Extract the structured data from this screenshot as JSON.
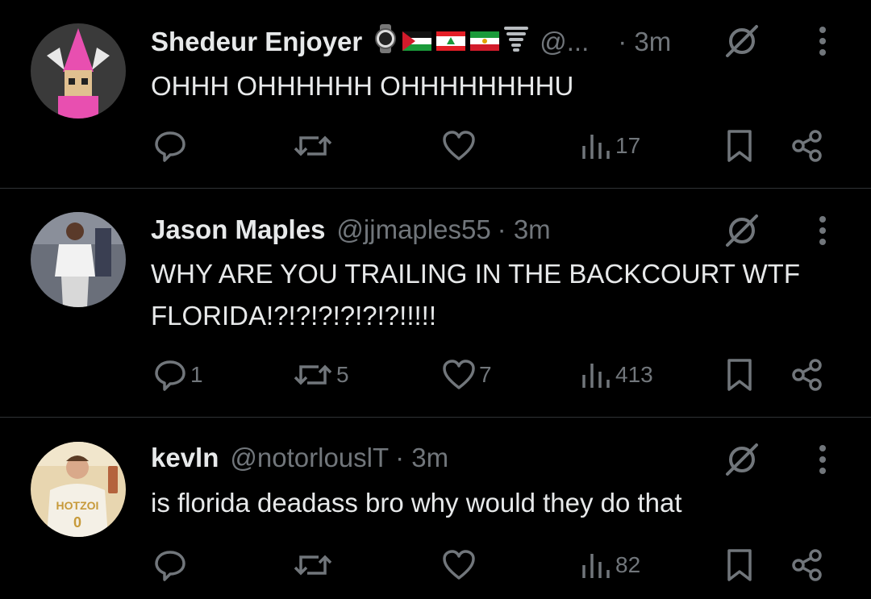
{
  "posts": [
    {
      "name": "Shedeur Enjoyer",
      "handle": "@...",
      "time": "· 3m",
      "emojis": [
        "watch-emoji",
        "palestine-flag-emoji",
        "lebanon-flag-emoji",
        "iran-lion-sun-flag-emoji",
        "tornado-emoji"
      ],
      "text_lines": [
        "OHHH OHHHHHH OHHHHHHHHU"
      ],
      "replies": "",
      "reposts": "",
      "likes": "",
      "views": "17"
    },
    {
      "name": "Jason Maples",
      "handle": "@jjmaples55",
      "time": "· 3m",
      "text_lines": [
        "WHY ARE YOU TRAILING IN THE BACKCOURT WTF",
        "FLORIDA!?!?!?!?!?!?!!!!!"
      ],
      "replies": "1",
      "reposts": "5",
      "likes": "7",
      "views": "413"
    },
    {
      "name": "kevln",
      "handle": "@notorlouslT",
      "time": "· 3m",
      "text_lines": [
        "is florida deadass bro why would they do that"
      ],
      "replies": "",
      "reposts": "",
      "likes": "",
      "views": "82"
    }
  ],
  "colors": {
    "background": "#000000",
    "primary_text": "#e7e9ea",
    "secondary_text": "#71767b",
    "divider": "#2f3336"
  }
}
